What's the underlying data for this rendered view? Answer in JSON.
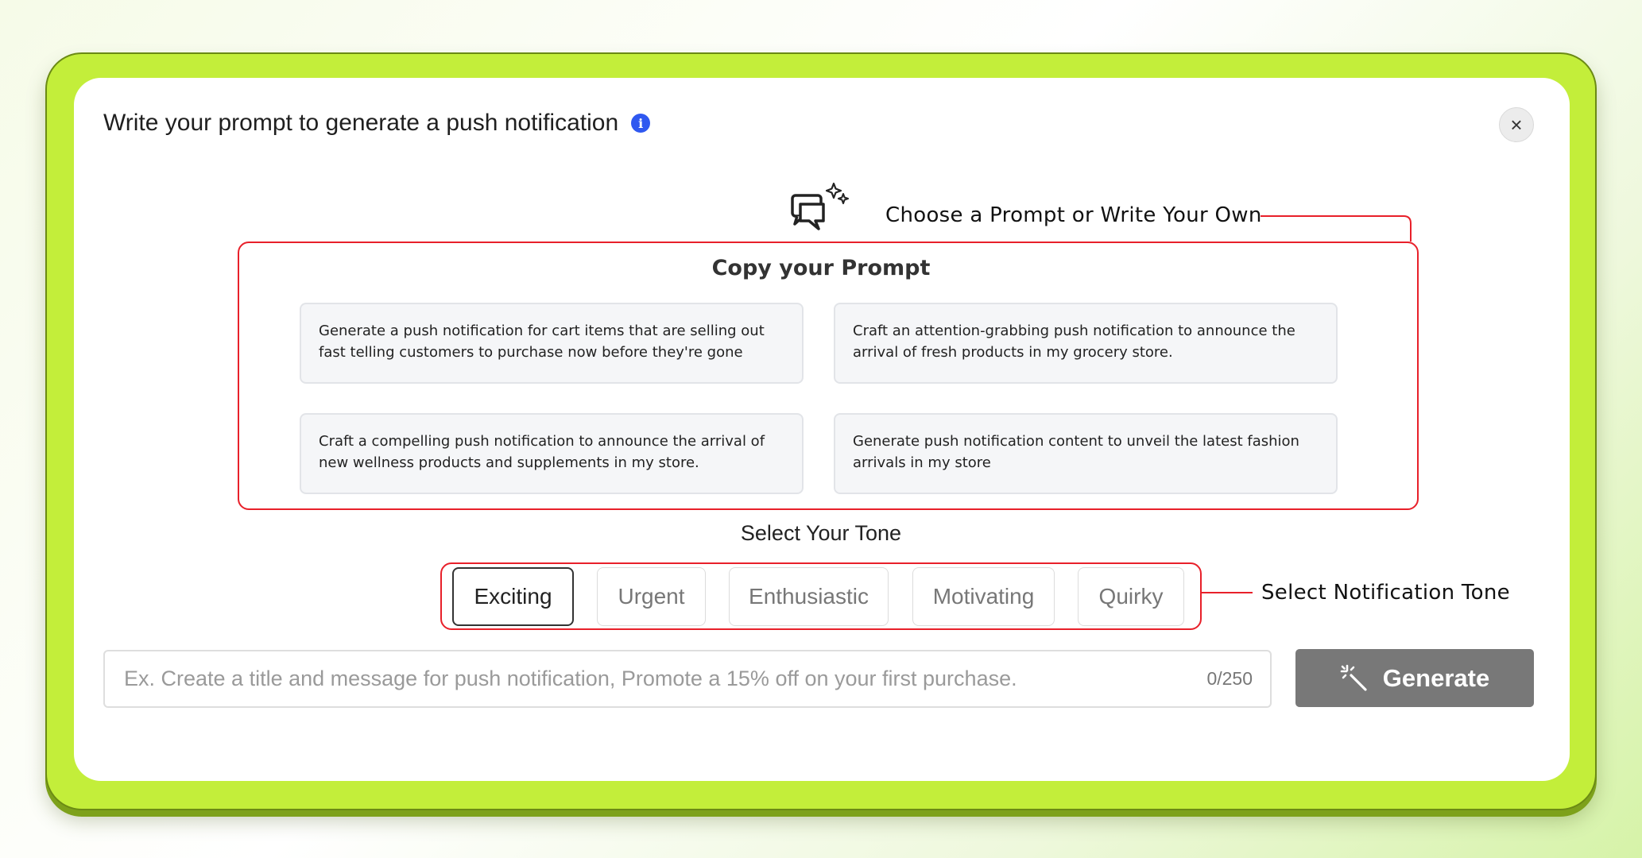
{
  "dialog": {
    "title": "Write your prompt to generate a push notification",
    "info_icon": "i",
    "close_icon": "×"
  },
  "annotations": {
    "choose_prompt": "Choose a Prompt or Write Your Own",
    "select_tone": "Select Notification Tone",
    "accent_color": "#e8202a"
  },
  "prompts": {
    "title": "Copy your Prompt",
    "items": [
      {
        "text": "Generate a push notification for cart items that are selling out fast telling customers to purchase now before they're gone"
      },
      {
        "text": "Craft an attention-grabbing push notification to announce the arrival of fresh products in my grocery store."
      },
      {
        "text": "Craft a compelling push notification to announce the arrival of new wellness products and supplements in my store."
      },
      {
        "text": "Generate push notification content to unveil the latest fashion arrivals in my store"
      }
    ]
  },
  "tone": {
    "title": "Select Your Tone",
    "selected": "Exciting",
    "options": [
      {
        "label": "Exciting"
      },
      {
        "label": "Urgent"
      },
      {
        "label": "Enthusiastic"
      },
      {
        "label": "Motivating"
      },
      {
        "label": "Quirky"
      }
    ]
  },
  "input": {
    "value": "",
    "placeholder": "Ex. Create a title and message for push notification, Promote a 15% off on your first purchase.",
    "counter": "0/250"
  },
  "generate": {
    "label": "Generate",
    "icon": "magic-wand-icon",
    "color": "#787878"
  },
  "colors": {
    "frame": "#c3ee3a",
    "info": "#2f58f0"
  }
}
